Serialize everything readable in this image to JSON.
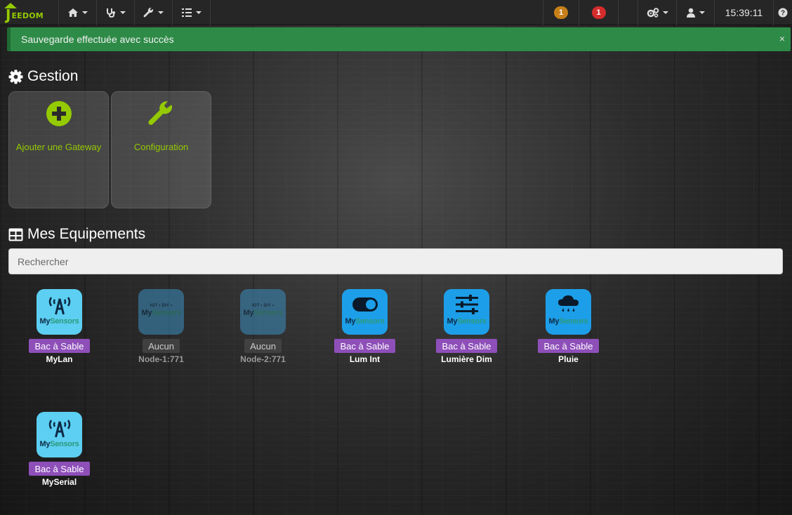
{
  "navbar": {
    "brand_text": "EEDOM",
    "menus": [
      {
        "icon": "home-icon"
      },
      {
        "icon": "stethoscope-icon"
      },
      {
        "icon": "wrench-icon"
      },
      {
        "icon": "tasks-icon"
      }
    ],
    "badge_warning": "1",
    "badge_danger": "1",
    "settings_icon": "cogs-icon",
    "user_icon": "user-icon",
    "time": "15:39:11",
    "help_icon": "question-circle-icon",
    "colors": {
      "warning": "#c77f1a",
      "danger": "#d42c2c",
      "brand": "#94ca02"
    }
  },
  "alert": {
    "text": "Sauvegarde effectuée avec succès",
    "close": "×",
    "color": "#2e8b47"
  },
  "gestion": {
    "title": "Gestion",
    "cards": [
      {
        "label": "Ajouter une Gateway",
        "icon": "plus-circle-icon"
      },
      {
        "label": "Configuration",
        "icon": "wrench-icon"
      }
    ]
  },
  "equipements": {
    "title": "Mes Equipements",
    "search_placeholder": "Rechercher",
    "brand_my": "My",
    "brand_sensors": "Sensors",
    "iot_text": "IOT • DIY •",
    "items": [
      {
        "name": "MyLan",
        "tag": "Bac à Sable",
        "icon": "antenna-icon"
      },
      {
        "name": "Node-1:771",
        "tag": "Aucun",
        "icon": "mysensors-logo-icon"
      },
      {
        "name": "Node-2:771",
        "tag": "Aucun",
        "icon": "mysensors-logo-icon"
      },
      {
        "name": "Lum Int",
        "tag": "Bac à Sable",
        "icon": "toggle-icon"
      },
      {
        "name": "Lumière Dim",
        "tag": "Bac à Sable",
        "icon": "sliders-icon"
      },
      {
        "name": "Pluie",
        "tag": "Bac à Sable",
        "icon": "rain-cloud-icon"
      },
      {
        "name": "MySerial",
        "tag": "Bac à Sable",
        "icon": "antenna-icon"
      }
    ]
  }
}
